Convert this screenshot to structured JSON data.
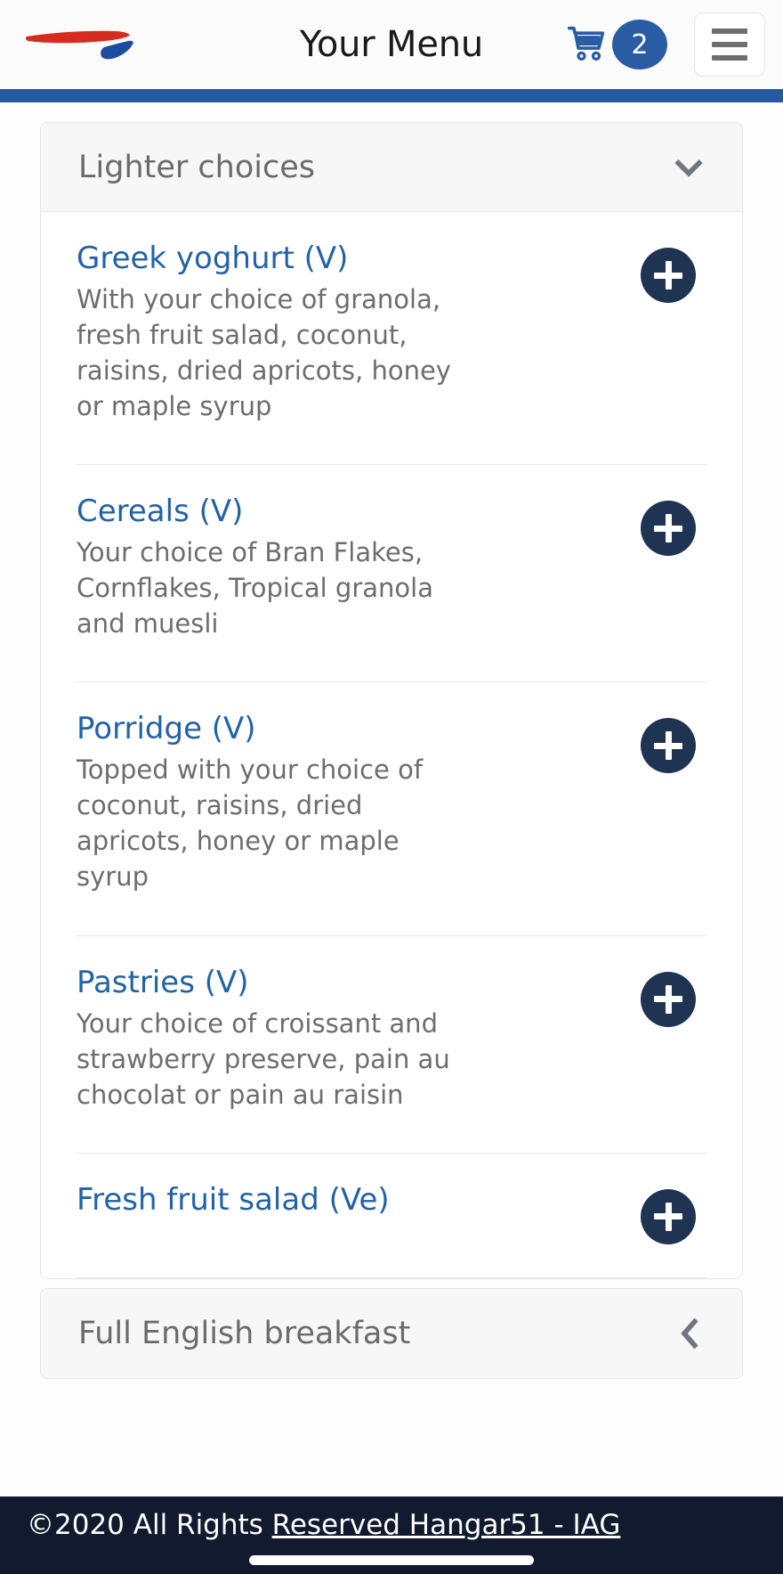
{
  "header": {
    "logo_name": "british-airways-speedmarque-logo",
    "title": "Your Menu",
    "cart_icon": "shopping-cart-icon",
    "cart_count": "2",
    "menu_icon": "hamburger-menu-icon"
  },
  "colors": {
    "brand_red": "#d62b1f",
    "brand_blue": "#1a4da2",
    "rule_blue": "#2559a0",
    "link_blue": "#2362a8",
    "badge_blue": "#2a5ca4",
    "add_button_navy": "#1f3352",
    "footer_navy": "#111a2e",
    "section_header_bg": "#f7f7f7",
    "muted_text": "#6d6d6d"
  },
  "sections": [
    {
      "title": "Lighter choices",
      "expanded": true,
      "chevron": "chevron-down-icon",
      "items": [
        {
          "title": "Greek yoghurt (V)",
          "desc": "With your choice of granola, fresh fruit salad, coconut, raisins, dried apricots, honey or maple syrup",
          "add_label": "plus-icon"
        },
        {
          "title": "Cereals (V)",
          "desc": "Your choice of Bran Flakes, Cornflakes, Tropical granola and muesli",
          "add_label": "plus-icon"
        },
        {
          "title": "Porridge (V)",
          "desc": "Topped with your choice of coconut, raisins, dried apricots, honey or maple syrup",
          "add_label": "plus-icon"
        },
        {
          "title": "Pastries (V)",
          "desc": "Your choice of croissant and strawberry preserve, pain au chocolat or pain au raisin",
          "add_label": "plus-icon"
        },
        {
          "title": "Fresh fruit salad (Ve)",
          "desc": "",
          "add_label": "plus-icon"
        }
      ]
    },
    {
      "title": "Full English breakfast",
      "expanded": false,
      "chevron": "chevron-left-icon",
      "items": []
    }
  ],
  "footer": {
    "copyright_plain": "©2020 All Rights ",
    "copyright_underlined": "Reserved Hangar51 - IAG"
  }
}
